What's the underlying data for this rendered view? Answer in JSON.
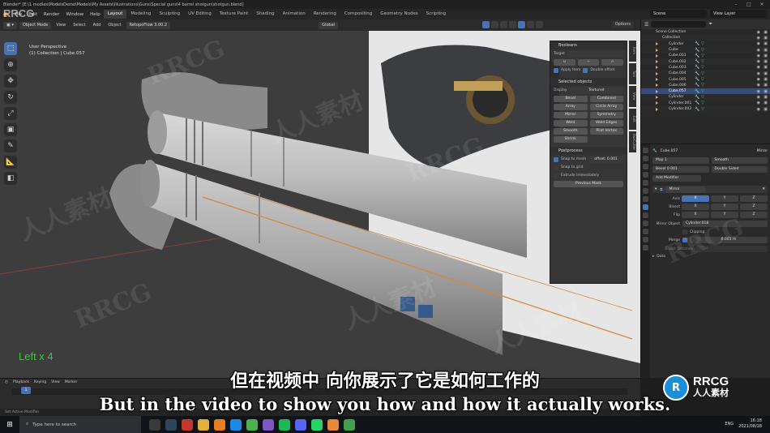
{
  "window": {
    "title": "Blender* [E:\\1 modles\\ModelsDemo\\Models\\My Assets\\Illustrations\\Guns\\Special guns\\4 barrel shotgun\\shotgun.blend]"
  },
  "brand_corner": "RRCG",
  "menubar": {
    "items": [
      "File",
      "Edit",
      "Render",
      "Window",
      "Help"
    ],
    "tabs": [
      "Layout",
      "Modeling",
      "Sculpting",
      "UV Editing",
      "Texture Paint",
      "Shading",
      "Animation",
      "Rendering",
      "Compositing",
      "Geometry Nodes",
      "Scripting"
    ],
    "active_tab": "Layout",
    "scene": "Scene",
    "view_layer": "View Layer"
  },
  "viewport_header": {
    "mode": "Object Mode",
    "items": [
      "View",
      "Select",
      "Add",
      "Object"
    ],
    "addon": "RetopoFlow 3.00.2",
    "orientation": "Global",
    "options": "Options"
  },
  "viewport": {
    "view_name": "User Perspective",
    "collection_line": "(1) Collection | Cube.057",
    "operator_text": "Left x 4"
  },
  "float_panel": {
    "sections": {
      "bool": "Booleans",
      "selected": "Selected objects",
      "postprocess": "Postprocess"
    },
    "target_label": "Target",
    "apply_label": "Apply Item",
    "double_label": "Double offset",
    "display_label": "Display",
    "display_value": "Textured",
    "buttons": [
      "Bevel",
      "Combined",
      "Array",
      "Circle Array",
      "Mirror",
      "Symmetry",
      "Weld",
      "Weld Edges",
      "Smooth",
      "Pilot Vertex",
      "Shrink"
    ],
    "snap_label": "Snap to mesh",
    "snap_value": "offset: 0.001",
    "snap_grid": "Snap to grid",
    "extrude": "Extrude Immediately",
    "bake": "Previous Mask"
  },
  "outliner": {
    "title": "Scene Collection",
    "rows": [
      {
        "name": "Scene Collection",
        "sel": false
      },
      {
        "name": "Collection",
        "sel": false
      },
      {
        "name": "Cylinder",
        "sel": false
      },
      {
        "name": "Cube",
        "sel": false
      },
      {
        "name": "Cube.001",
        "sel": false
      },
      {
        "name": "Cube.002",
        "sel": false
      },
      {
        "name": "Cube.003",
        "sel": false
      },
      {
        "name": "Cube.004",
        "sel": false
      },
      {
        "name": "Cube.005",
        "sel": false
      },
      {
        "name": "Cube.006",
        "sel": false
      },
      {
        "name": "Cube.057",
        "sel": true
      },
      {
        "name": "Cylinder",
        "sel": false
      },
      {
        "name": "Cylinder.001",
        "sel": false
      },
      {
        "name": "Cylinder.002",
        "sel": false
      }
    ]
  },
  "properties": {
    "object_name": "Cube.057",
    "modifier_dropdown": "Mirror",
    "add_modifier": "Add Modifier",
    "modifier_name": "Mirror",
    "axis_label": "Axis",
    "bisect_label": "Bisect",
    "flip_label": "Flip",
    "axes": [
      "X",
      "Y",
      "Z"
    ],
    "mirror_object_label": "Mirror Object",
    "mirror_object_value": "Cylinder.018",
    "clipping_label": "Clipping",
    "merge_label": "Merge",
    "merge_value": "0.001 m",
    "bisect_distance": "Bisect Distance",
    "data_label": "Data",
    "weight_label": "Map 1",
    "shade_label": "Smooth",
    "bevel_label": "Bevel 0.001",
    "double_label": "Double Sided"
  },
  "timeline": {
    "items": [
      "Playback",
      "Keying",
      "View",
      "Marker"
    ],
    "frame": "1"
  },
  "statusbar": {
    "text": "Set Active Modifier"
  },
  "taskbar": {
    "search_placeholder": "Type here to search",
    "lang": "ENG",
    "time": "16:18",
    "date": "2021/08/18"
  },
  "subtitles": {
    "cn": "但在视频中 向你展示了它是如何工作的",
    "en": "But in the video to show you how and how it actually works."
  },
  "watermarks": {
    "rrcg": "RRCG",
    "cn_mark": "人人素材"
  },
  "colors": {
    "accent": "#4772b3",
    "outliner_triangle": "#f0a46c",
    "operator_text": "#27d42a",
    "orange_logo": "#e8893a"
  }
}
